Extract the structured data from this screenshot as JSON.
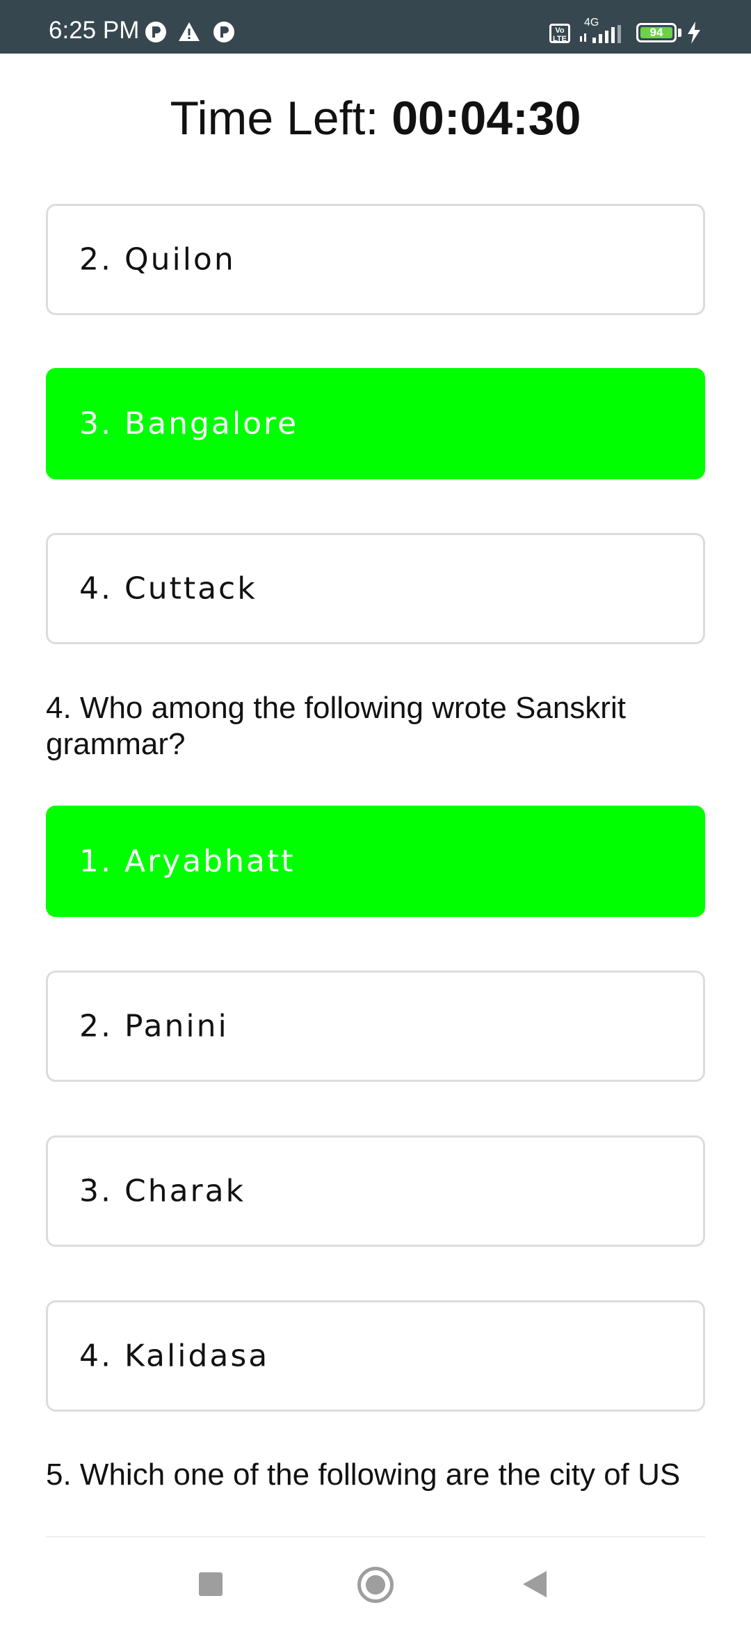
{
  "status_bar": {
    "time": "6:25 PM",
    "volte": "Vo LTE",
    "network": "4G",
    "battery": "94",
    "icons": [
      "notification-p-icon",
      "warning-icon",
      "notification-p-icon",
      "signal-icon",
      "battery-icon",
      "charging-bolt-icon"
    ]
  },
  "timer": {
    "label": "Time Left: ",
    "value": "00:04:30"
  },
  "quiz": {
    "q3_options": [
      {
        "label": "2. Quilon",
        "selected": false
      },
      {
        "label": "3. Bangalore",
        "selected": true
      },
      {
        "label": "4. Cuttack",
        "selected": false
      }
    ],
    "q4": {
      "question": "4. Who among the following wrote Sanskrit grammar?",
      "options": [
        {
          "label": "1. Aryabhatt",
          "selected": true
        },
        {
          "label": "2. Panini",
          "selected": false
        },
        {
          "label": "3. Charak",
          "selected": false
        },
        {
          "label": "4. Kalidasa",
          "selected": false
        }
      ]
    },
    "q5": {
      "question": "5. Which one of the following are the city of US"
    }
  },
  "colors": {
    "status_bar": "#37474f",
    "selected": "#00ff00",
    "border": "#dcdcdc"
  }
}
